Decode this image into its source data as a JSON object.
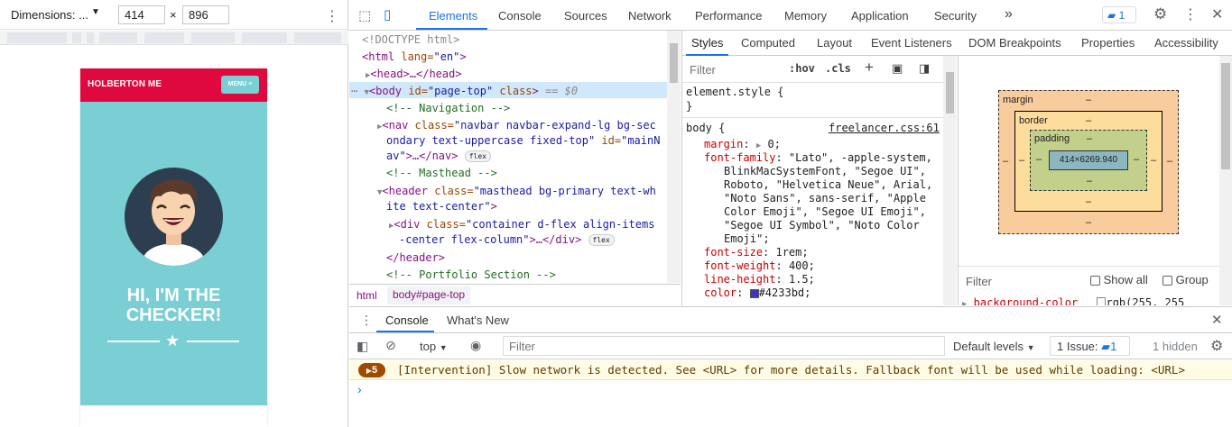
{
  "device_toolbar": {
    "dimensions_label": "Dimensions: ...",
    "width_value": "414",
    "times": "×",
    "height_value": "896",
    "more_glyph": "⋮"
  },
  "site": {
    "brand": "HOLBERTON ME",
    "menu_label": "MENU ≡",
    "hero_line1": "HI, I'M THE",
    "hero_line2": "CHECKER!",
    "primary_color": "#79cfd4",
    "nav_color": "#e0093f"
  },
  "devtools": {
    "tabs": [
      "Elements",
      "Console",
      "Sources",
      "Network",
      "Performance",
      "Memory",
      "Application",
      "Security"
    ],
    "more_tabs": "»",
    "issues_count": "1",
    "accent": "#1a73e8"
  },
  "dom": {
    "l1": "<!DOCTYPE html>",
    "html_open": "<html",
    "html_attr": " lang=",
    "html_val": "\"en\"",
    "html_close": ">",
    "head": "<head>…</head>",
    "body_open": "<body",
    "body_attr1": " id=",
    "body_val1": "\"page-top\"",
    "body_attr2": " class",
    "body_close": ">",
    "body_eq": " == $0",
    "c_nav": "<!-- Navigation -->",
    "nav_l1_tag": "<nav",
    "nav_l1_attr": " class=",
    "nav_l1_val": "\"navbar navbar-expand-lg bg-sec",
    "nav_l2_val": "ondary text-uppercase fixed-top\"",
    "nav_l2_attr": " id=",
    "nav_l2_val2": "\"mainN",
    "nav_l3_val": "av\"",
    "nav_l3_tag": ">…</nav>",
    "flex": "flex",
    "c_mast": "<!-- Masthead -->",
    "hdr_tag": "<header",
    "hdr_attr": " class=",
    "hdr_val": "\"masthead bg-primary text-wh",
    "hdr_val2": "ite text-center\"",
    "hdr_close": ">",
    "div_tag": "<div",
    "div_attr": " class=",
    "div_val": "\"container d-flex align-items",
    "div_val2": "-center flex-column\"",
    "div_close": ">…</div>",
    "hdr_end": "</header>",
    "c_port": "<!-- Portfolio Section -->"
  },
  "breadcrumb": {
    "html": "html",
    "body": "body#page-top"
  },
  "styles_tabs": [
    "Styles",
    "Computed",
    "Layout",
    "Event Listeners",
    "DOM Breakpoints",
    "Properties",
    "Accessibility"
  ],
  "styles": {
    "filter_placeholder": "Filter",
    "hov": ":hov",
    "cls": ".cls",
    "plus": "+",
    "element_style": "element.style {",
    "close_brace": "}",
    "body_selector": "body {",
    "source": "freelancer.css:61",
    "margin_prop": "margin",
    "margin_val": "0;",
    "ff_prop": "font-family",
    "ff_v1": "\"Lato\", -apple-system,",
    "ff_v2": "BlinkMacSystemFont, \"Segoe UI\",",
    "ff_v3": "Roboto, \"Helvetica Neue\", Arial,",
    "ff_v4": "\"Noto Sans\", sans-serif, \"Apple",
    "ff_v5": "Color Emoji\", \"Segoe UI Emoji\",",
    "ff_v6": "\"Segoe UI Symbol\", \"Noto Color",
    "ff_v7": "Emoji\";",
    "fs_prop": "font-size",
    "fs_val": "1rem;",
    "fw_prop": "font-weight",
    "fw_val": "400;",
    "lh_prop": "line-height",
    "lh_val": "1.5;",
    "color_prop": "color",
    "color_val": "#4233bd;",
    "color_swatch": "#4233bd"
  },
  "boxmodel": {
    "margin_label": "margin",
    "border_label": "border",
    "padding_label": "padding",
    "dash": "–",
    "content": "414×6269.940"
  },
  "computed": {
    "filter": "Filter",
    "show_all": "Show all",
    "group": "Group",
    "bg_prop": "background-color",
    "bg_val": "rgb(255, 255"
  },
  "drawer": {
    "tabs": [
      "Console",
      "What's New"
    ],
    "context": "top",
    "filter_placeholder": "Filter",
    "levels": "Default levels",
    "issue_label": "1 Issue:",
    "issue_count": "1",
    "hidden": "1 hidden",
    "warn_count": "5",
    "warn_message": "[Intervention] Slow network is detected. See <URL> for more details. Fallback font will be used while loading: <URL>",
    "prompt": "›"
  }
}
